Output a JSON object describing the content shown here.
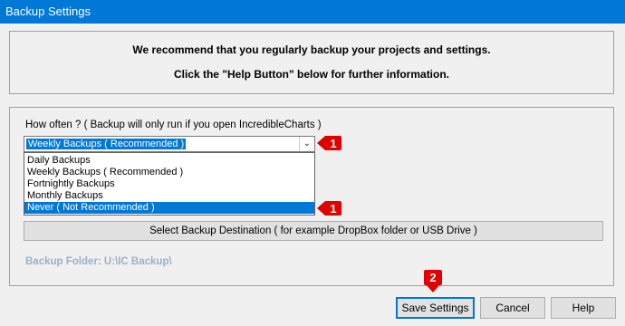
{
  "window": {
    "title": "Backup Settings"
  },
  "info": {
    "line1": "We recommend that you regularly backup your projects and settings.",
    "line2": "Click the \"Help Button\" below for further information."
  },
  "frequency": {
    "label": "How often ? ( Backup will only run if you open IncredibleCharts )",
    "selected": "Weekly Backups  ( Recommended )",
    "options": [
      "Daily Backups",
      "Weekly Backups  ( Recommended )",
      "Fortnightly Backups",
      "Monthly Backups",
      "Never  ( Not Recommended )"
    ],
    "highlighted_option": "Never  ( Not Recommended )"
  },
  "destination_button": "Select Backup Destination  ( for example DropBox folder or USB Drive )",
  "backup_folder": "Backup Folder: U:\\IC Backup\\",
  "buttons": {
    "save": "Save Settings",
    "cancel": "Cancel",
    "help": "Help"
  },
  "markers": {
    "combo": "1",
    "never_option": "1",
    "save": "2"
  },
  "colors": {
    "titlebar": "#0078d7",
    "selection": "#0078d7",
    "marker": "#e00000",
    "folder_text": "#9bb0c8"
  }
}
